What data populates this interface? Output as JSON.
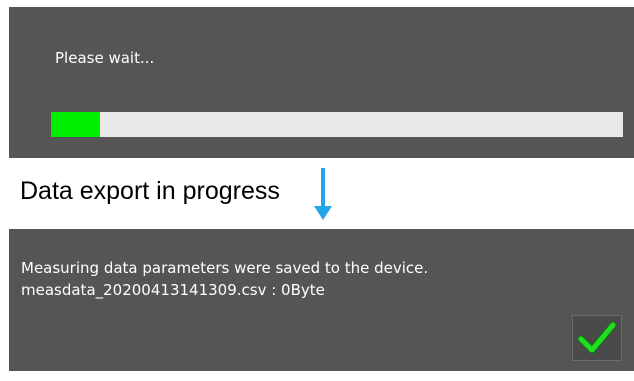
{
  "wait_dialog": {
    "message": "Please wait...",
    "progress": 0.086
  },
  "caption": {
    "text": "Data export in progress",
    "arrow_icon": "arrow-down-icon",
    "arrow_color": "#21a6e8"
  },
  "done_dialog": {
    "line1": "Measuring data parameters were saved to the device.",
    "line2": "measdata_20200413141309.csv : 0Byte",
    "ok_icon": "checkmark-icon",
    "ok_color": "#22dd22"
  },
  "colors": {
    "panel": "#555555",
    "progress_fill": "#00ee00",
    "progress_track": "#e9e9e9"
  }
}
